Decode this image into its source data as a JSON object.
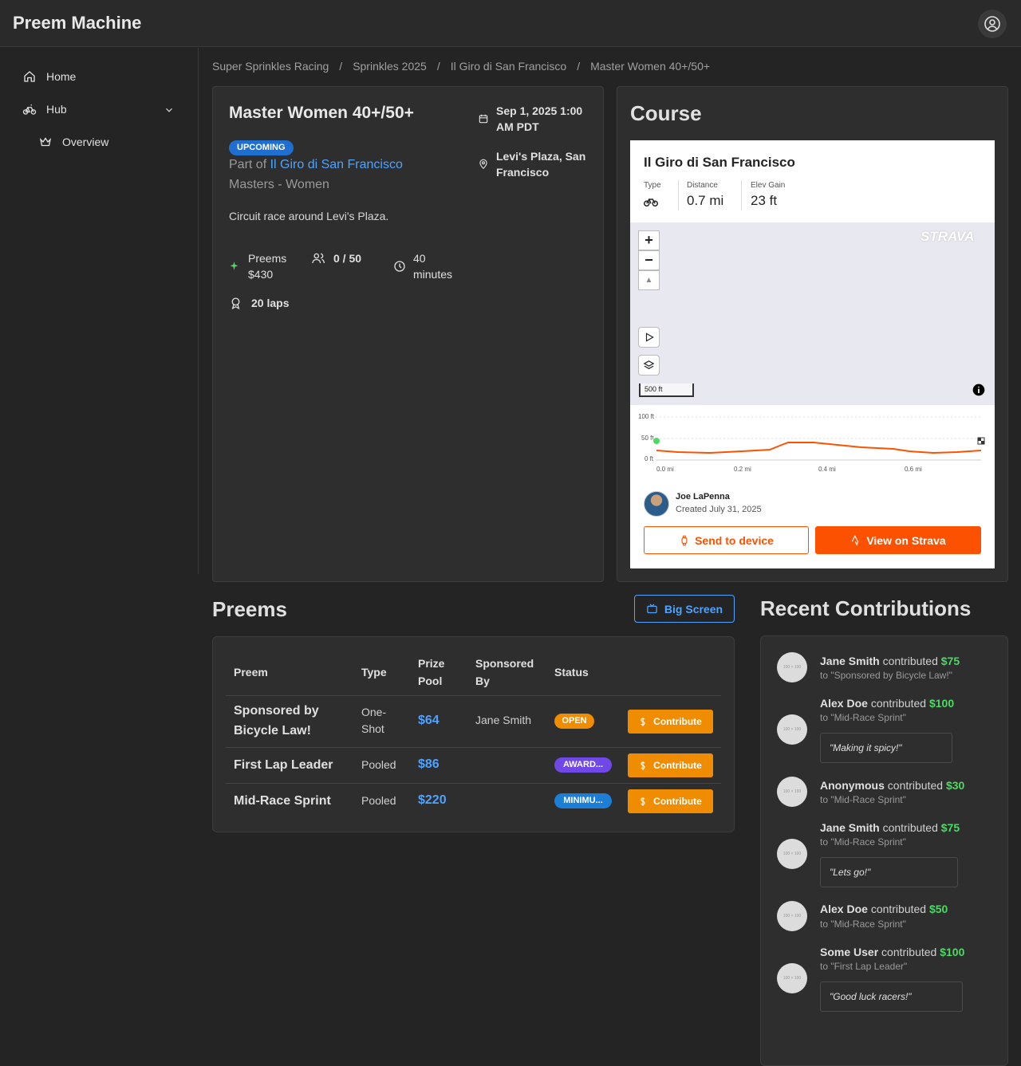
{
  "app": {
    "title": "Preem Machine"
  },
  "sidebar": {
    "items": [
      {
        "label": "Home"
      },
      {
        "label": "Hub"
      },
      {
        "label": "Overview"
      }
    ]
  },
  "breadcrumbs": [
    "Super Sprinkles Racing",
    "Sprinkles 2025",
    "Il Giro di San Francisco",
    "Master Women 40+/50+"
  ],
  "race": {
    "title": "Master Women 40+/50+",
    "status": "UPCOMING",
    "part_of_prefix": "Part of",
    "event_link": "Il Giro di San Francisco",
    "category": "Masters - Women",
    "description": "Circuit race around Levi's Plaza.",
    "date_line1": "Sep 1, 2025 1:00",
    "date_line2": "AM PDT",
    "location_line1": "Levi's Plaza, San",
    "location_line2": "Francisco",
    "preems_label": "Preems",
    "preems_total": "$430",
    "participants": "0 / 50",
    "duration_value": "40",
    "duration_unit": "minutes",
    "laps": "20 laps"
  },
  "course": {
    "title": "Course",
    "route_name": "Il Giro di San Francisco",
    "type_label": "Type",
    "distance_label": "Distance",
    "distance": "0.7 mi",
    "elev_label": "Elev Gain",
    "elev": "23 ft",
    "strava_logo": "STRAVA",
    "scale": "500 ft",
    "elev_y_labels": [
      "100 ft",
      "50 ft",
      "0 ft"
    ],
    "elev_x_labels": [
      "0.0 mi",
      "0.2 mi",
      "0.4 mi",
      "0.6 mi"
    ],
    "creator_name": "Joe LaPenna",
    "created": "Created July 31, 2025",
    "send_label": "Send to device",
    "view_label": "View on Strava",
    "brand_color": "#fc5200"
  },
  "preems": {
    "title": "Preems",
    "big_screen": "Big Screen",
    "headers": {
      "preem": "Preem",
      "type": "Type",
      "prize_line1": "Prize",
      "prize_line2": "Pool",
      "sponsor_line1": "Sponsored",
      "sponsor_line2": "By",
      "status": "Status"
    },
    "rows": [
      {
        "name_line1": "Sponsored by",
        "name_line2": "Bicycle Law!",
        "type_line1": "One-",
        "type_line2": "Shot",
        "pool": "$64",
        "sponsor": "Jane Smith",
        "status": "OPEN",
        "status_color": "#f08c00",
        "action": "Contribute"
      },
      {
        "name": "First Lap Leader",
        "type": "Pooled",
        "pool": "$86",
        "sponsor": "",
        "status": "AWARD...",
        "status_color": "#7048e8",
        "action": "Contribute"
      },
      {
        "name": "Mid-Race Sprint",
        "type": "Pooled",
        "pool": "$220",
        "sponsor": "",
        "status": "MINIMU...",
        "status_color": "#1c7ed6",
        "action": "Contribute"
      }
    ]
  },
  "recent": {
    "title": "Recent Contributions",
    "avatar_placeholder": "100 × 100",
    "verb": "contributed",
    "items": [
      {
        "name": "Jane Smith",
        "amount": "$75",
        "to": "to \"Sponsored by Bicycle Law!\"",
        "message": ""
      },
      {
        "name": "Alex Doe",
        "amount": "$100",
        "to": "to \"Mid-Race Sprint\"",
        "message": "\"Making it spicy!\""
      },
      {
        "name": "Anonymous",
        "amount": "$30",
        "to": "to \"Mid-Race Sprint\"",
        "message": ""
      },
      {
        "name": "Jane Smith",
        "amount": "$75",
        "to": "to \"Mid-Race Sprint\"",
        "message": "\"Lets go!\""
      },
      {
        "name": "Alex Doe",
        "amount": "$50",
        "to": "to \"Mid-Race Sprint\"",
        "message": ""
      },
      {
        "name": "Some User",
        "amount": "$100",
        "to": "to \"First Lap Leader\"",
        "message": "\"Good luck racers!\""
      }
    ]
  }
}
